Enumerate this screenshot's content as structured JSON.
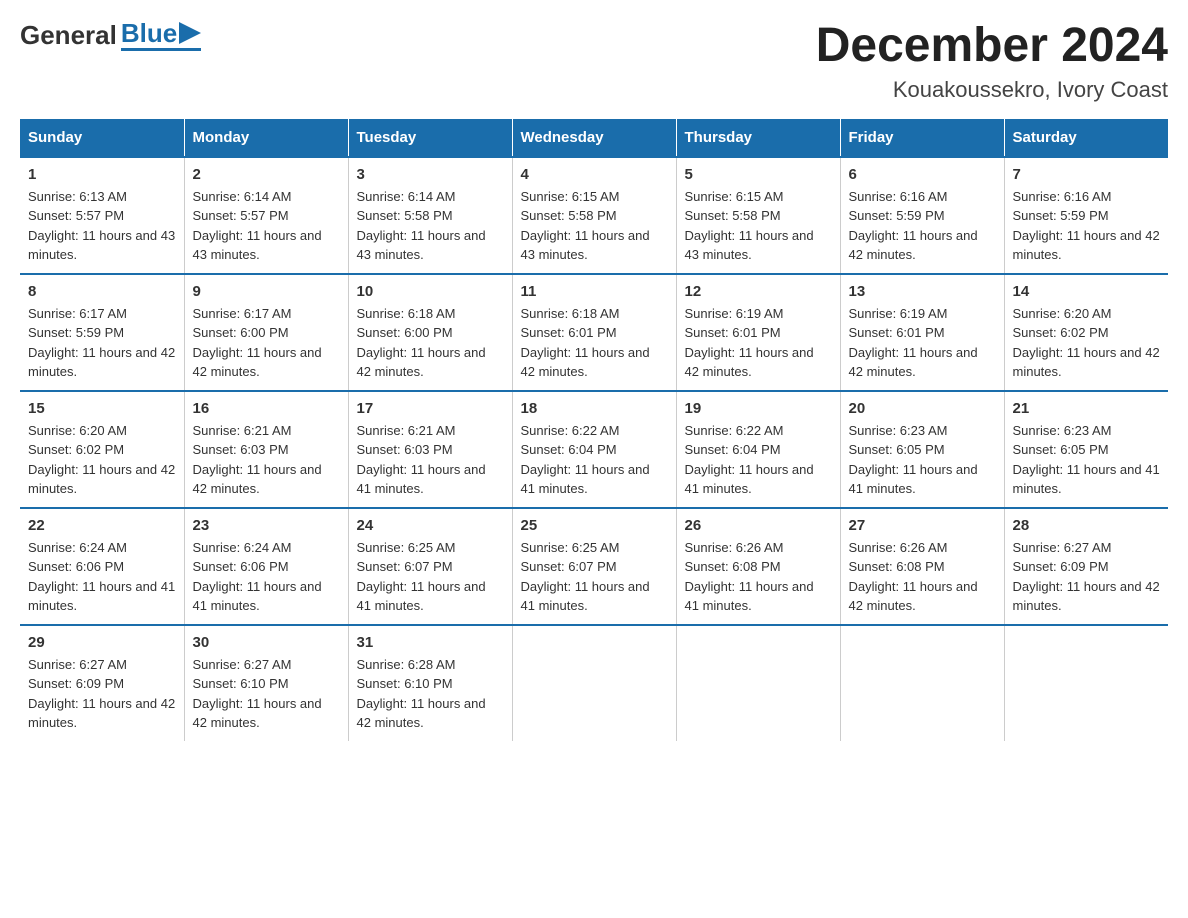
{
  "logo": {
    "general": "General",
    "blue": "Blue"
  },
  "title": "December 2024",
  "subtitle": "Kouakoussekro, Ivory Coast",
  "days_of_week": [
    "Sunday",
    "Monday",
    "Tuesday",
    "Wednesday",
    "Thursday",
    "Friday",
    "Saturday"
  ],
  "weeks": [
    [
      {
        "day": "1",
        "sunrise": "6:13 AM",
        "sunset": "5:57 PM",
        "daylight": "11 hours and 43 minutes."
      },
      {
        "day": "2",
        "sunrise": "6:14 AM",
        "sunset": "5:57 PM",
        "daylight": "11 hours and 43 minutes."
      },
      {
        "day": "3",
        "sunrise": "6:14 AM",
        "sunset": "5:58 PM",
        "daylight": "11 hours and 43 minutes."
      },
      {
        "day": "4",
        "sunrise": "6:15 AM",
        "sunset": "5:58 PM",
        "daylight": "11 hours and 43 minutes."
      },
      {
        "day": "5",
        "sunrise": "6:15 AM",
        "sunset": "5:58 PM",
        "daylight": "11 hours and 43 minutes."
      },
      {
        "day": "6",
        "sunrise": "6:16 AM",
        "sunset": "5:59 PM",
        "daylight": "11 hours and 42 minutes."
      },
      {
        "day": "7",
        "sunrise": "6:16 AM",
        "sunset": "5:59 PM",
        "daylight": "11 hours and 42 minutes."
      }
    ],
    [
      {
        "day": "8",
        "sunrise": "6:17 AM",
        "sunset": "5:59 PM",
        "daylight": "11 hours and 42 minutes."
      },
      {
        "day": "9",
        "sunrise": "6:17 AM",
        "sunset": "6:00 PM",
        "daylight": "11 hours and 42 minutes."
      },
      {
        "day": "10",
        "sunrise": "6:18 AM",
        "sunset": "6:00 PM",
        "daylight": "11 hours and 42 minutes."
      },
      {
        "day": "11",
        "sunrise": "6:18 AM",
        "sunset": "6:01 PM",
        "daylight": "11 hours and 42 minutes."
      },
      {
        "day": "12",
        "sunrise": "6:19 AM",
        "sunset": "6:01 PM",
        "daylight": "11 hours and 42 minutes."
      },
      {
        "day": "13",
        "sunrise": "6:19 AM",
        "sunset": "6:01 PM",
        "daylight": "11 hours and 42 minutes."
      },
      {
        "day": "14",
        "sunrise": "6:20 AM",
        "sunset": "6:02 PM",
        "daylight": "11 hours and 42 minutes."
      }
    ],
    [
      {
        "day": "15",
        "sunrise": "6:20 AM",
        "sunset": "6:02 PM",
        "daylight": "11 hours and 42 minutes."
      },
      {
        "day": "16",
        "sunrise": "6:21 AM",
        "sunset": "6:03 PM",
        "daylight": "11 hours and 42 minutes."
      },
      {
        "day": "17",
        "sunrise": "6:21 AM",
        "sunset": "6:03 PM",
        "daylight": "11 hours and 41 minutes."
      },
      {
        "day": "18",
        "sunrise": "6:22 AM",
        "sunset": "6:04 PM",
        "daylight": "11 hours and 41 minutes."
      },
      {
        "day": "19",
        "sunrise": "6:22 AM",
        "sunset": "6:04 PM",
        "daylight": "11 hours and 41 minutes."
      },
      {
        "day": "20",
        "sunrise": "6:23 AM",
        "sunset": "6:05 PM",
        "daylight": "11 hours and 41 minutes."
      },
      {
        "day": "21",
        "sunrise": "6:23 AM",
        "sunset": "6:05 PM",
        "daylight": "11 hours and 41 minutes."
      }
    ],
    [
      {
        "day": "22",
        "sunrise": "6:24 AM",
        "sunset": "6:06 PM",
        "daylight": "11 hours and 41 minutes."
      },
      {
        "day": "23",
        "sunrise": "6:24 AM",
        "sunset": "6:06 PM",
        "daylight": "11 hours and 41 minutes."
      },
      {
        "day": "24",
        "sunrise": "6:25 AM",
        "sunset": "6:07 PM",
        "daylight": "11 hours and 41 minutes."
      },
      {
        "day": "25",
        "sunrise": "6:25 AM",
        "sunset": "6:07 PM",
        "daylight": "11 hours and 41 minutes."
      },
      {
        "day": "26",
        "sunrise": "6:26 AM",
        "sunset": "6:08 PM",
        "daylight": "11 hours and 41 minutes."
      },
      {
        "day": "27",
        "sunrise": "6:26 AM",
        "sunset": "6:08 PM",
        "daylight": "11 hours and 42 minutes."
      },
      {
        "day": "28",
        "sunrise": "6:27 AM",
        "sunset": "6:09 PM",
        "daylight": "11 hours and 42 minutes."
      }
    ],
    [
      {
        "day": "29",
        "sunrise": "6:27 AM",
        "sunset": "6:09 PM",
        "daylight": "11 hours and 42 minutes."
      },
      {
        "day": "30",
        "sunrise": "6:27 AM",
        "sunset": "6:10 PM",
        "daylight": "11 hours and 42 minutes."
      },
      {
        "day": "31",
        "sunrise": "6:28 AM",
        "sunset": "6:10 PM",
        "daylight": "11 hours and 42 minutes."
      },
      {
        "day": "",
        "sunrise": "",
        "sunset": "",
        "daylight": ""
      },
      {
        "day": "",
        "sunrise": "",
        "sunset": "",
        "daylight": ""
      },
      {
        "day": "",
        "sunrise": "",
        "sunset": "",
        "daylight": ""
      },
      {
        "day": "",
        "sunrise": "",
        "sunset": "",
        "daylight": ""
      }
    ]
  ],
  "labels": {
    "sunrise": "Sunrise:",
    "sunset": "Sunset:",
    "daylight": "Daylight:"
  },
  "colors": {
    "header_bg": "#1a6dab",
    "header_text": "#ffffff",
    "border": "#1a6dab",
    "accent": "#1a6dab"
  }
}
